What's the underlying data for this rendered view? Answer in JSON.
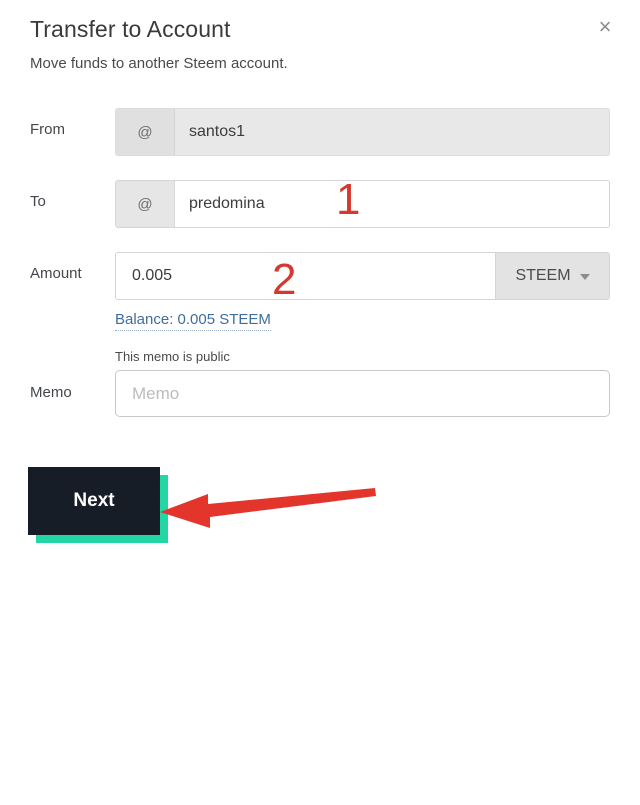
{
  "dialog": {
    "title": "Transfer to Account",
    "subtitle": "Move funds to another Steem account.",
    "close_label": "×"
  },
  "form": {
    "from": {
      "label": "From",
      "prefix": "@",
      "value": "santos1",
      "placeholder": ""
    },
    "to": {
      "label": "To",
      "prefix": "@",
      "value": "predomina",
      "placeholder": ""
    },
    "amount": {
      "label": "Amount",
      "value": "0.005",
      "placeholder": "",
      "asset": "STEEM",
      "balance_link": "Balance: 0.005 STEEM"
    },
    "memo": {
      "label": "Memo",
      "hint": "This memo is public",
      "value": "",
      "placeholder": "Memo"
    }
  },
  "actions": {
    "next_label": "Next"
  },
  "annotations": {
    "step_one": "1",
    "step_two": "2",
    "arrow_color": "#e3352b",
    "number_color": "#d6372f"
  },
  "colors": {
    "button_bg": "#171d26",
    "button_shadow": "#24d6a3",
    "link": "#3f6d9e",
    "field_prefix_bg": "#e6e6e6",
    "disabled_field_bg": "#e8e8e8"
  }
}
